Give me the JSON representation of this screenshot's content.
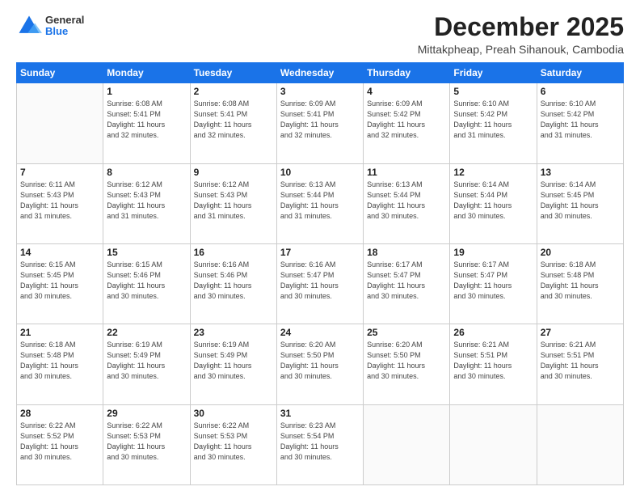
{
  "logo": {
    "general": "General",
    "blue": "Blue"
  },
  "header": {
    "month": "December 2025",
    "location": "Mittakpheap, Preah Sihanouk, Cambodia"
  },
  "weekdays": [
    "Sunday",
    "Monday",
    "Tuesday",
    "Wednesday",
    "Thursday",
    "Friday",
    "Saturday"
  ],
  "weeks": [
    [
      {
        "day": "",
        "info": ""
      },
      {
        "day": "1",
        "info": "Sunrise: 6:08 AM\nSunset: 5:41 PM\nDaylight: 11 hours\nand 32 minutes."
      },
      {
        "day": "2",
        "info": "Sunrise: 6:08 AM\nSunset: 5:41 PM\nDaylight: 11 hours\nand 32 minutes."
      },
      {
        "day": "3",
        "info": "Sunrise: 6:09 AM\nSunset: 5:41 PM\nDaylight: 11 hours\nand 32 minutes."
      },
      {
        "day": "4",
        "info": "Sunrise: 6:09 AM\nSunset: 5:42 PM\nDaylight: 11 hours\nand 32 minutes."
      },
      {
        "day": "5",
        "info": "Sunrise: 6:10 AM\nSunset: 5:42 PM\nDaylight: 11 hours\nand 31 minutes."
      },
      {
        "day": "6",
        "info": "Sunrise: 6:10 AM\nSunset: 5:42 PM\nDaylight: 11 hours\nand 31 minutes."
      }
    ],
    [
      {
        "day": "7",
        "info": "Sunrise: 6:11 AM\nSunset: 5:43 PM\nDaylight: 11 hours\nand 31 minutes."
      },
      {
        "day": "8",
        "info": "Sunrise: 6:12 AM\nSunset: 5:43 PM\nDaylight: 11 hours\nand 31 minutes."
      },
      {
        "day": "9",
        "info": "Sunrise: 6:12 AM\nSunset: 5:43 PM\nDaylight: 11 hours\nand 31 minutes."
      },
      {
        "day": "10",
        "info": "Sunrise: 6:13 AM\nSunset: 5:44 PM\nDaylight: 11 hours\nand 31 minutes."
      },
      {
        "day": "11",
        "info": "Sunrise: 6:13 AM\nSunset: 5:44 PM\nDaylight: 11 hours\nand 30 minutes."
      },
      {
        "day": "12",
        "info": "Sunrise: 6:14 AM\nSunset: 5:44 PM\nDaylight: 11 hours\nand 30 minutes."
      },
      {
        "day": "13",
        "info": "Sunrise: 6:14 AM\nSunset: 5:45 PM\nDaylight: 11 hours\nand 30 minutes."
      }
    ],
    [
      {
        "day": "14",
        "info": "Sunrise: 6:15 AM\nSunset: 5:45 PM\nDaylight: 11 hours\nand 30 minutes."
      },
      {
        "day": "15",
        "info": "Sunrise: 6:15 AM\nSunset: 5:46 PM\nDaylight: 11 hours\nand 30 minutes."
      },
      {
        "day": "16",
        "info": "Sunrise: 6:16 AM\nSunset: 5:46 PM\nDaylight: 11 hours\nand 30 minutes."
      },
      {
        "day": "17",
        "info": "Sunrise: 6:16 AM\nSunset: 5:47 PM\nDaylight: 11 hours\nand 30 minutes."
      },
      {
        "day": "18",
        "info": "Sunrise: 6:17 AM\nSunset: 5:47 PM\nDaylight: 11 hours\nand 30 minutes."
      },
      {
        "day": "19",
        "info": "Sunrise: 6:17 AM\nSunset: 5:47 PM\nDaylight: 11 hours\nand 30 minutes."
      },
      {
        "day": "20",
        "info": "Sunrise: 6:18 AM\nSunset: 5:48 PM\nDaylight: 11 hours\nand 30 minutes."
      }
    ],
    [
      {
        "day": "21",
        "info": "Sunrise: 6:18 AM\nSunset: 5:48 PM\nDaylight: 11 hours\nand 30 minutes."
      },
      {
        "day": "22",
        "info": "Sunrise: 6:19 AM\nSunset: 5:49 PM\nDaylight: 11 hours\nand 30 minutes."
      },
      {
        "day": "23",
        "info": "Sunrise: 6:19 AM\nSunset: 5:49 PM\nDaylight: 11 hours\nand 30 minutes."
      },
      {
        "day": "24",
        "info": "Sunrise: 6:20 AM\nSunset: 5:50 PM\nDaylight: 11 hours\nand 30 minutes."
      },
      {
        "day": "25",
        "info": "Sunrise: 6:20 AM\nSunset: 5:50 PM\nDaylight: 11 hours\nand 30 minutes."
      },
      {
        "day": "26",
        "info": "Sunrise: 6:21 AM\nSunset: 5:51 PM\nDaylight: 11 hours\nand 30 minutes."
      },
      {
        "day": "27",
        "info": "Sunrise: 6:21 AM\nSunset: 5:51 PM\nDaylight: 11 hours\nand 30 minutes."
      }
    ],
    [
      {
        "day": "28",
        "info": "Sunrise: 6:22 AM\nSunset: 5:52 PM\nDaylight: 11 hours\nand 30 minutes."
      },
      {
        "day": "29",
        "info": "Sunrise: 6:22 AM\nSunset: 5:53 PM\nDaylight: 11 hours\nand 30 minutes."
      },
      {
        "day": "30",
        "info": "Sunrise: 6:22 AM\nSunset: 5:53 PM\nDaylight: 11 hours\nand 30 minutes."
      },
      {
        "day": "31",
        "info": "Sunrise: 6:23 AM\nSunset: 5:54 PM\nDaylight: 11 hours\nand 30 minutes."
      },
      {
        "day": "",
        "info": ""
      },
      {
        "day": "",
        "info": ""
      },
      {
        "day": "",
        "info": ""
      }
    ]
  ]
}
